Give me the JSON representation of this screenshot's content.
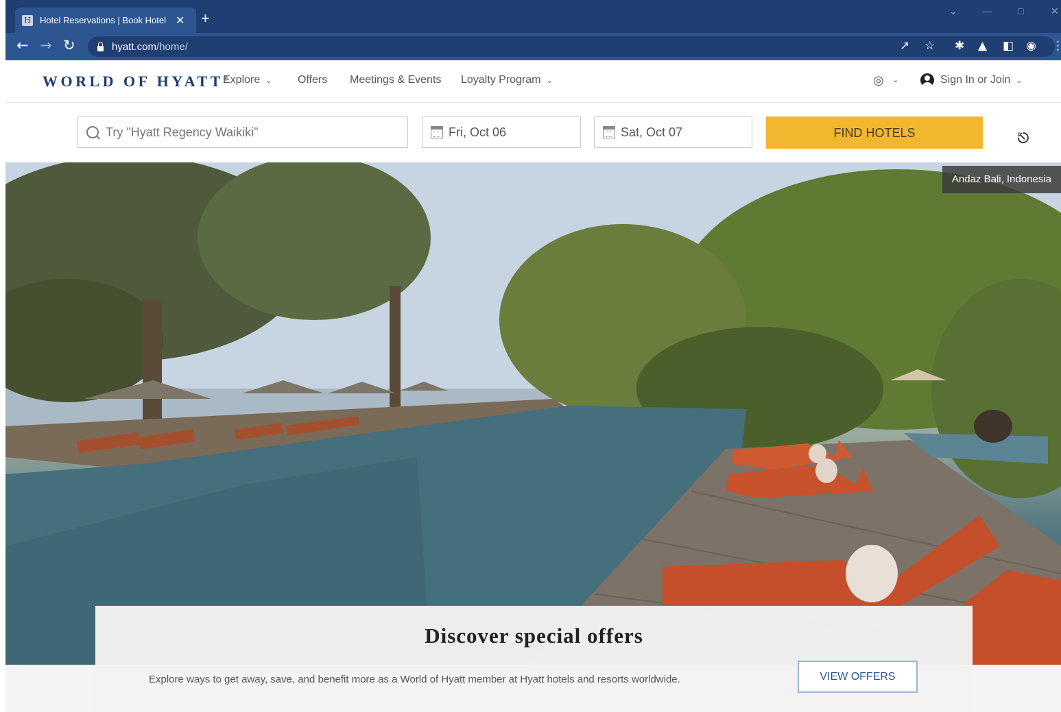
{
  "browser": {
    "tab_title": "Hotel Reservations | Book Hotel",
    "tab_favicon": "H",
    "tab_close": "✕",
    "new_tab": "+",
    "url_host": "hyatt.com",
    "url_path": "/home/"
  },
  "site": {
    "logo": "WORLD OF HYATT",
    "logo_mark": "®",
    "nav": {
      "explore": "Explore",
      "offers": "Offers",
      "meetings": "Meetings & Events",
      "loyalty": "Loyalty Program"
    },
    "sign_in": "Sign In or Join"
  },
  "search": {
    "destination_placeholder": "Try \"Hyatt Regency Waikiki\"",
    "check_in": "Fri, Oct 06",
    "check_out": "Sat, Oct 07",
    "find_button": "FIND HOTELS"
  },
  "hero": {
    "caption": "Andaz Bali, Indonesia"
  },
  "offers": {
    "title": "Discover special offers",
    "description": "Explore ways to get away, save, and benefit more as a World of Hyatt member at Hyatt hotels and resorts worldwide.",
    "button": "VIEW OFFERS"
  },
  "icons": {
    "back": "arrow-left-icon",
    "forward": "arrow-right-icon",
    "reload": "reload-icon",
    "lock": "lock-icon",
    "share": "share-icon",
    "star": "star-icon",
    "extensions": "puzzle-icon",
    "labs": "flask-icon",
    "sidebar": "sidebar-icon",
    "profile": "profile-icon",
    "menu": "kebab-menu-icon",
    "globe": "globe-icon",
    "account": "user-circle-icon",
    "search": "search-icon",
    "calendar": "calendar-icon"
  },
  "colors": {
    "chrome_dark": "#1f3e72",
    "chrome_tab": "#2d5592",
    "brand_navy": "#1f3c6e",
    "find_button": "#f1b72f",
    "view_offers_border": "#9fb3d3"
  }
}
